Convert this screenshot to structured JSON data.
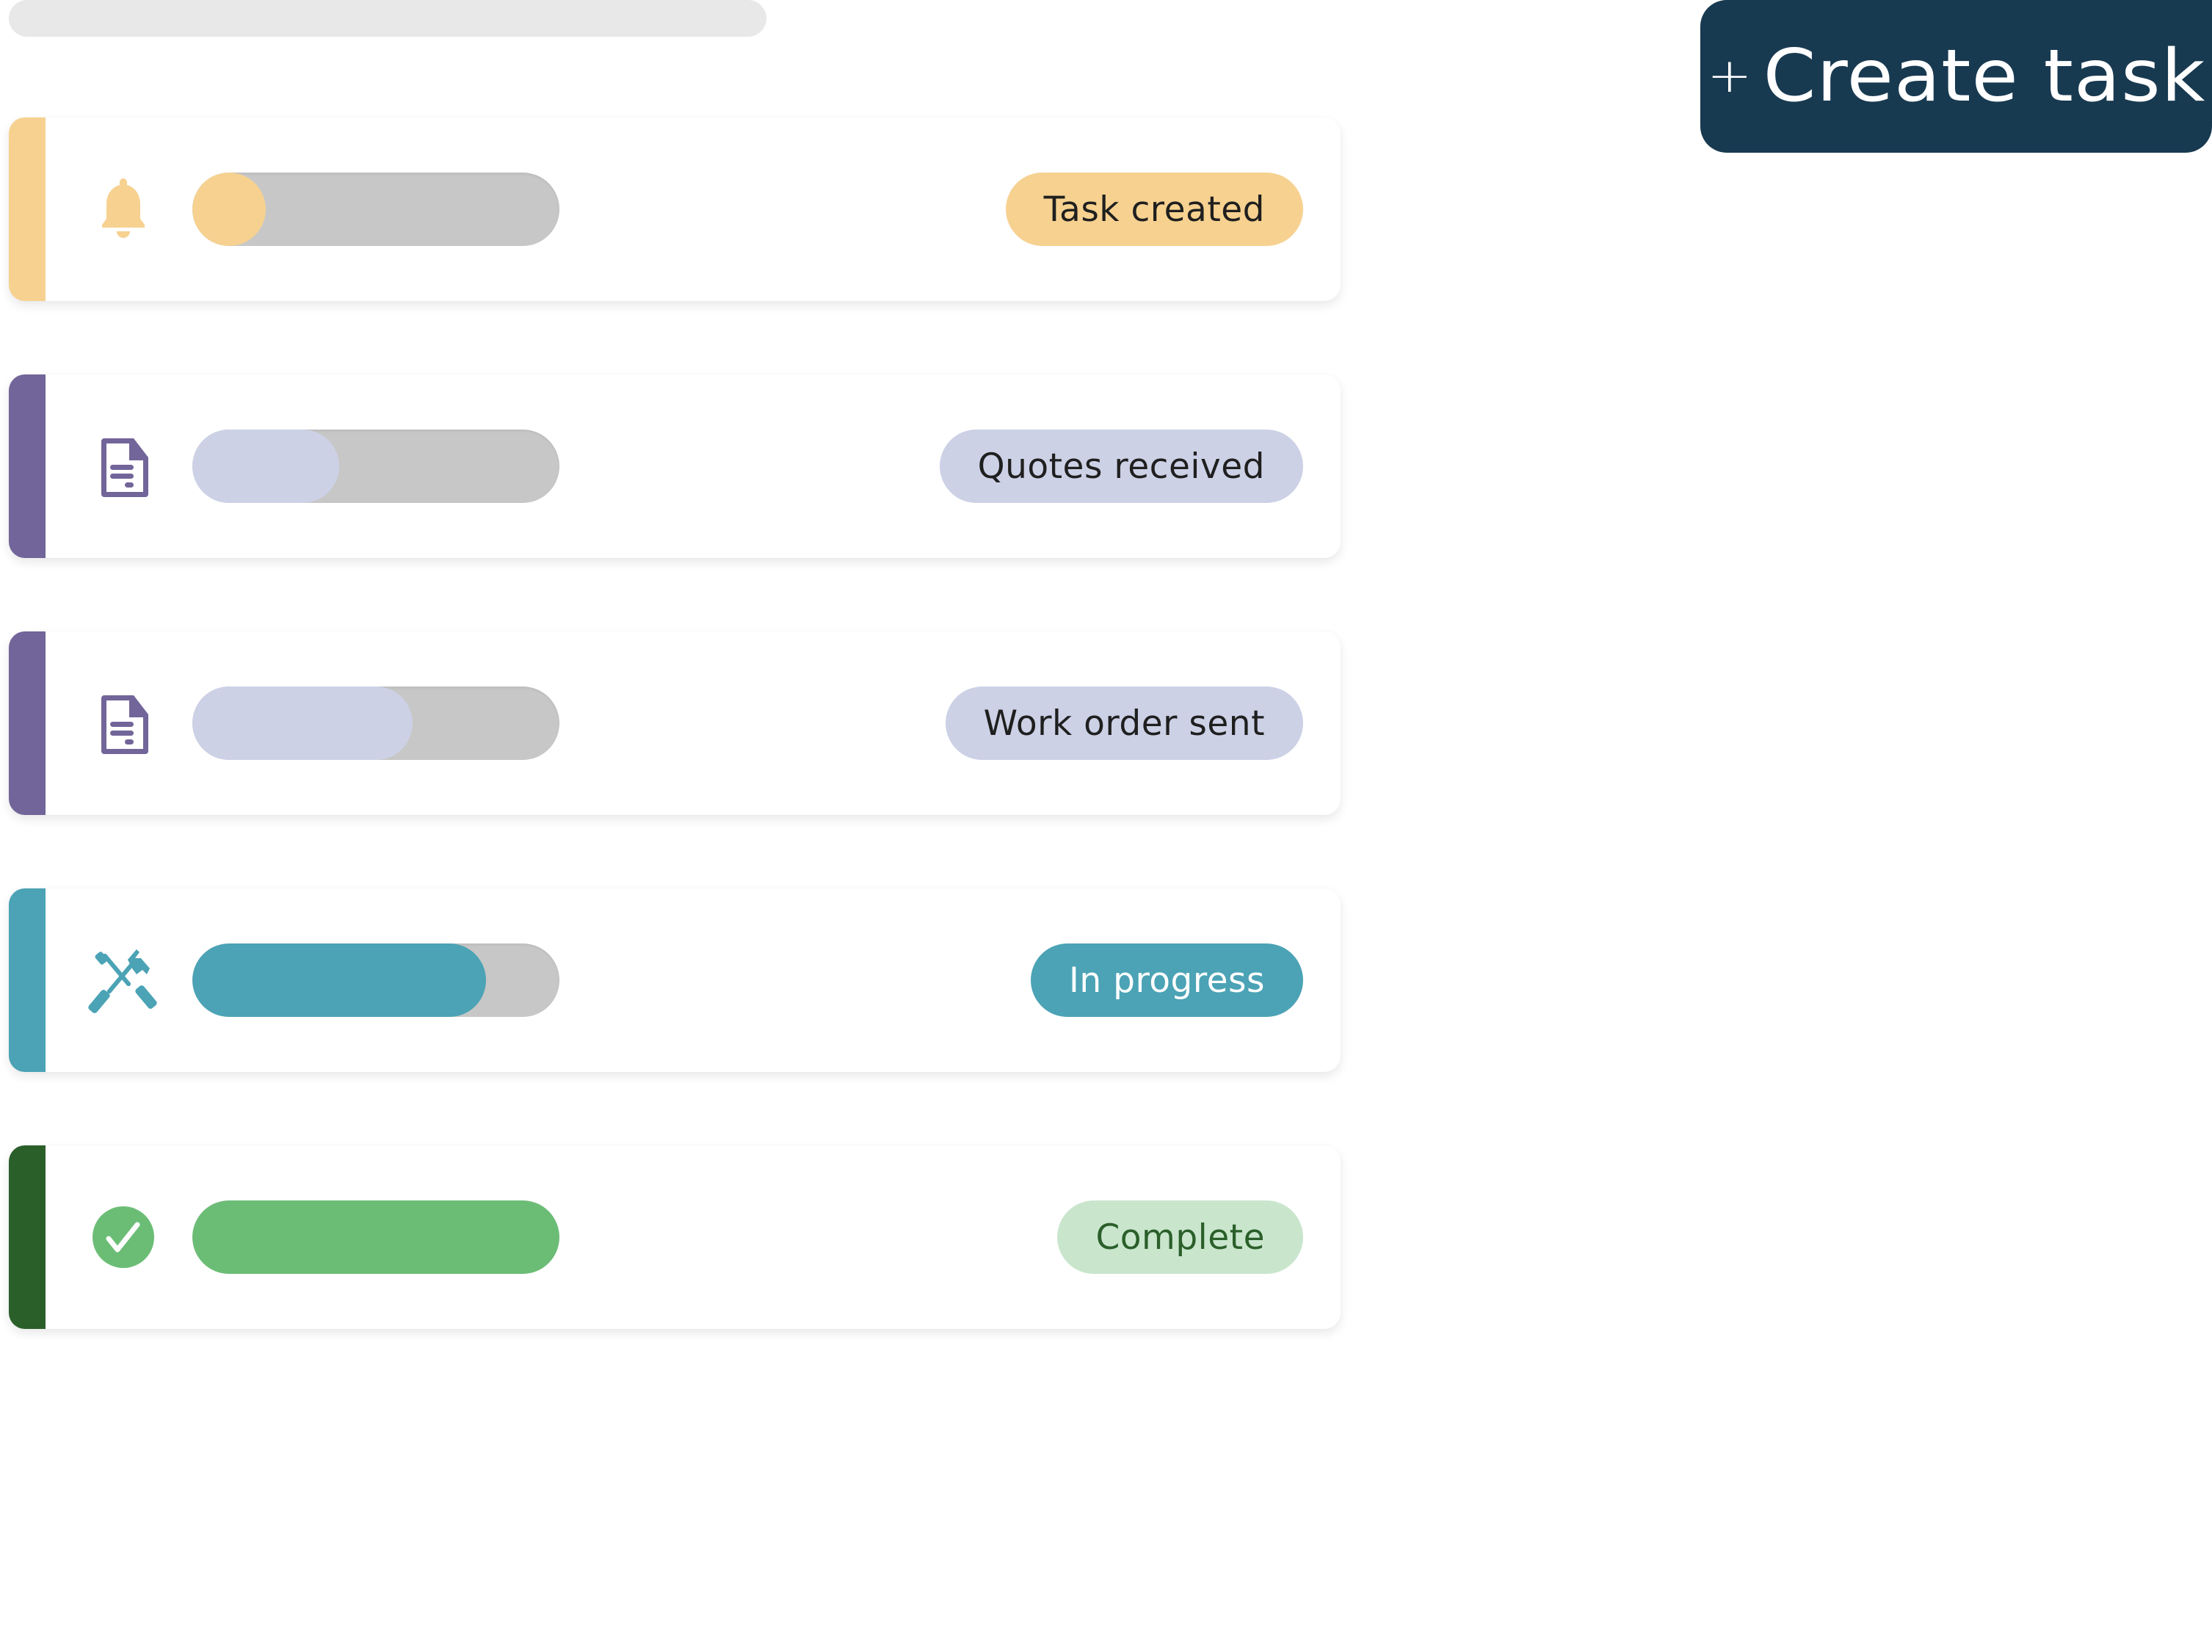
{
  "header": {
    "skeleton_placeholder": "",
    "create_button": {
      "icon": "plus-icon",
      "icon_glyph": "+",
      "label": "Create task",
      "background": "#183a51",
      "text_color": "#ffffff"
    }
  },
  "tasks": [
    {
      "status": "Task created",
      "icon": "bell-icon",
      "progress_percent": 20,
      "accent_color": "#f6d190",
      "fill_color": "#f6d190",
      "icon_color": "#f6d190",
      "pill_bg": "#f6d190",
      "pill_text_color": "#1f1f1f"
    },
    {
      "status": "Quotes received",
      "icon": "document-icon",
      "progress_percent": 40,
      "accent_color": "#726599",
      "fill_color": "#ccd1e6",
      "icon_color": "#726599",
      "pill_bg": "#ccd1e6",
      "pill_text_color": "#1f1f1f"
    },
    {
      "status": "Work order sent",
      "icon": "document-icon",
      "progress_percent": 60,
      "accent_color": "#726599",
      "fill_color": "#ccd1e6",
      "icon_color": "#726599",
      "pill_bg": "#ccd1e6",
      "pill_text_color": "#1f1f1f"
    },
    {
      "status": "In progress",
      "icon": "tools-icon",
      "progress_percent": 80,
      "accent_color": "#4ba3b5",
      "fill_color": "#4ba3b5",
      "icon_color": "#4ba3b5",
      "pill_bg": "#4ba3b5",
      "pill_text_color": "#ffffff"
    },
    {
      "status": "Complete",
      "icon": "check-circle-icon",
      "progress_percent": 100,
      "accent_color": "#2b5f2a",
      "fill_color": "#6bbd76",
      "icon_color": "#6bbd76",
      "pill_bg": "#c9e6cd",
      "pill_text_color": "#2b5f2a"
    }
  ],
  "colors": {
    "track": "#c7c7c7",
    "skeleton": "#e8e8e8",
    "card_bg": "#ffffff"
  }
}
